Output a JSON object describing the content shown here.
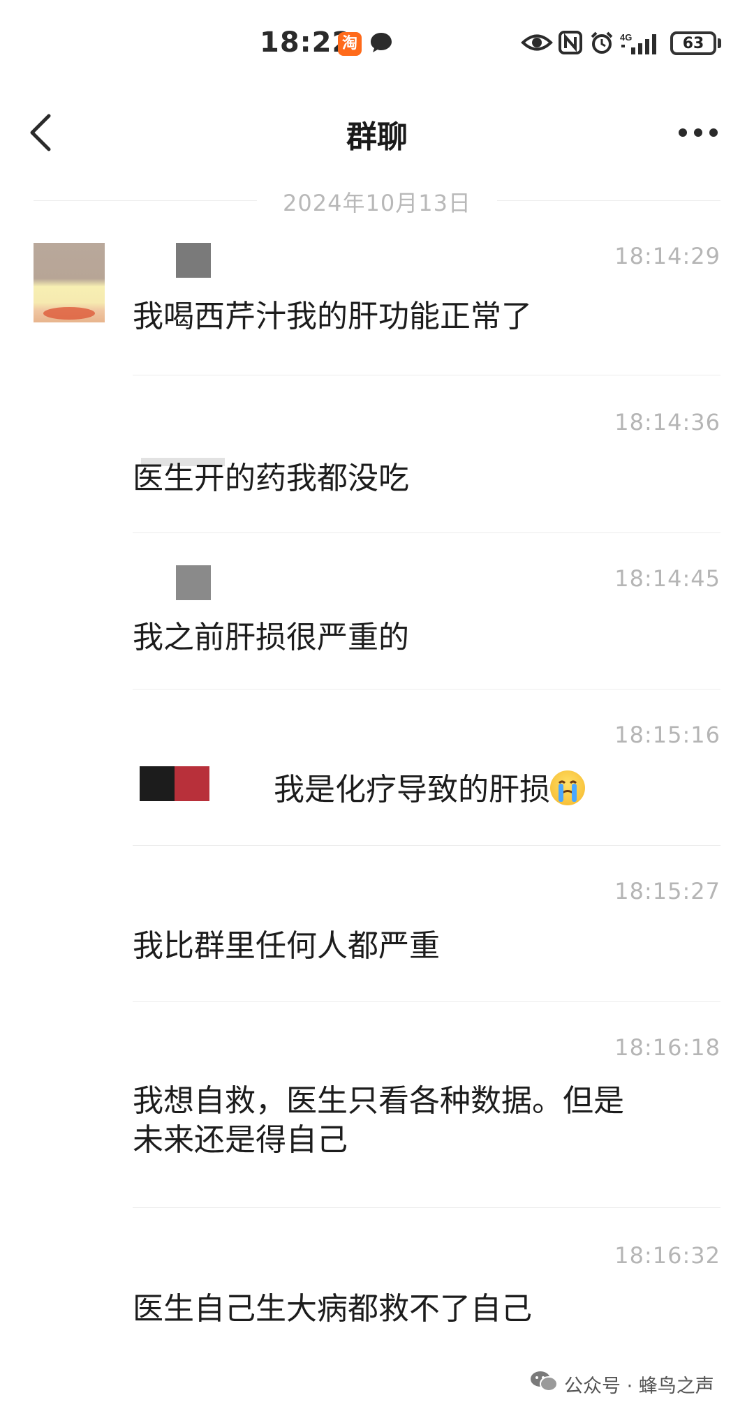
{
  "status_bar": {
    "time": "18:22",
    "taobao_glyph": "淘",
    "network": "4G",
    "battery": "63"
  },
  "header": {
    "title": "群聊"
  },
  "date_separator": "2024年10月13日",
  "messages": [
    {
      "time": "18:14:29",
      "text": "我喝西芹汁我的肝功能正常了"
    },
    {
      "time": "18:14:36",
      "text": "医生开的药我都没吃"
    },
    {
      "time": "18:14:45",
      "text": "我之前肝损很严重的"
    },
    {
      "time": "18:15:16",
      "text": "我是化疗导致的肝损"
    },
    {
      "time": "18:15:27",
      "text": "我比群里任何人都严重"
    },
    {
      "time": "18:16:18",
      "text": "我想自救，医生只看各种数据。但是\n未来还是得自己"
    },
    {
      "time": "18:16:32",
      "text": "医生自己生大病都救不了自己"
    }
  ],
  "watermark": {
    "text": "公众号 · 蜂鸟之声"
  },
  "icons": [
    "taobao-icon",
    "message-bubble-icon",
    "eye-icon",
    "nfc-icon",
    "alarm-icon",
    "signal-icon",
    "battery-icon",
    "back-arrow-icon",
    "more-icon",
    "crying-face-emoji",
    "wechat-logo-icon"
  ]
}
